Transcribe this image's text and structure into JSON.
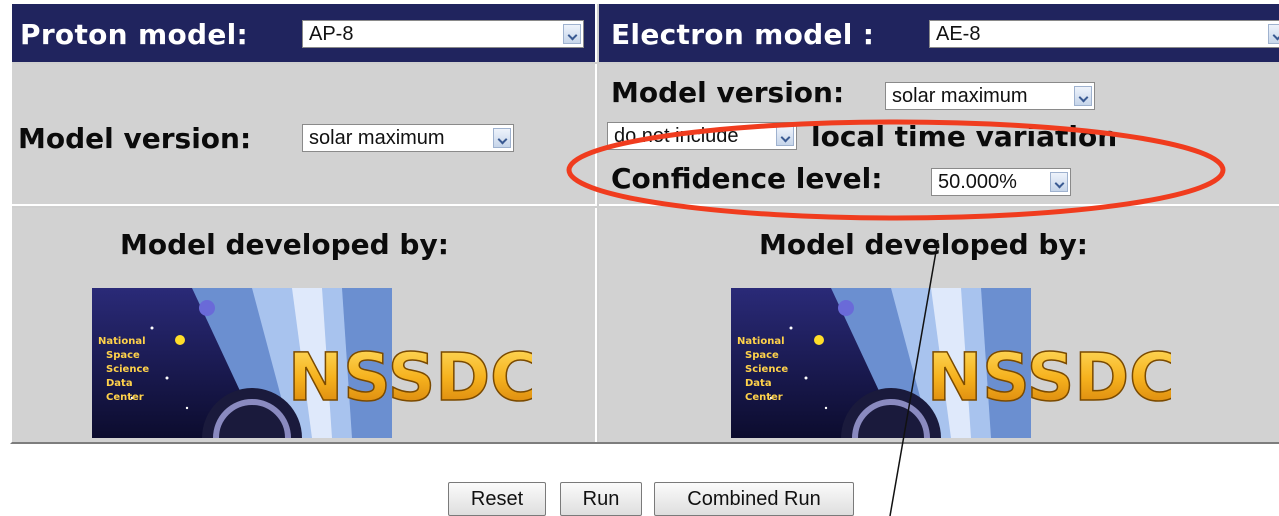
{
  "proton": {
    "title": "Proton model:",
    "model_select": "AP-8",
    "version_label": "Model version:",
    "version_select": "solar maximum",
    "developed_label": "Model developed by:"
  },
  "electron": {
    "title": "Electron model :",
    "model_select": "AE-8",
    "version_label": "Model version:",
    "version_select": "solar maximum",
    "local_time_select": "do not include",
    "local_time_label": "local time variation",
    "confidence_label": "Confidence level:",
    "confidence_select": "50.000%",
    "developed_label": "Model developed by:"
  },
  "logo": {
    "text": "NSSDC",
    "sub": [
      "National",
      "Space",
      "Science",
      "Data",
      "Center"
    ]
  },
  "buttons": {
    "reset": "Reset",
    "run": "Run",
    "combined_run": "Combined Run"
  },
  "colors": {
    "header_bg": "#20245e",
    "panel_bg": "#d2d2d2",
    "annotation": "#f03c1e"
  }
}
